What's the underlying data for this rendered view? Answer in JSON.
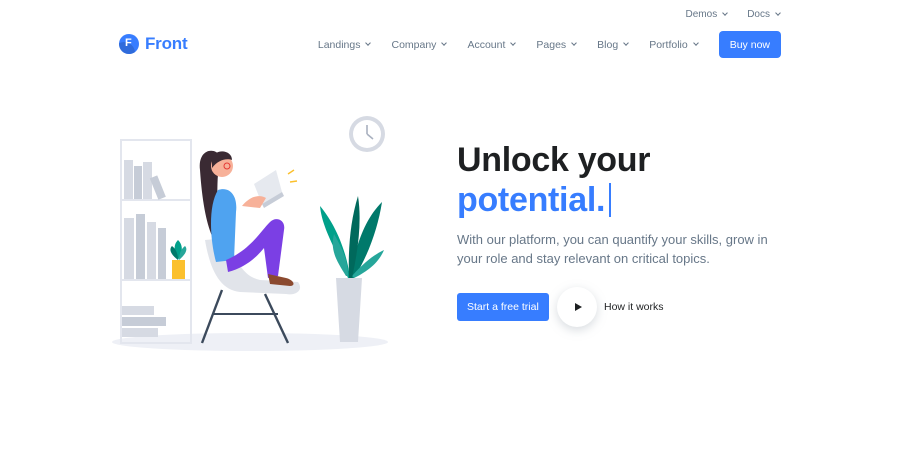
{
  "topbar": {
    "links": [
      {
        "label": "Demos"
      },
      {
        "label": "Docs"
      }
    ]
  },
  "header": {
    "logo_letter": "F",
    "logo_text": "Front",
    "nav": [
      {
        "label": "Landings"
      },
      {
        "label": "Company"
      },
      {
        "label": "Account"
      },
      {
        "label": "Pages"
      },
      {
        "label": "Blog"
      },
      {
        "label": "Portfolio"
      }
    ],
    "buy_label": "Buy now"
  },
  "hero": {
    "title_line1": "Unlock your",
    "title_line2": "potential.",
    "subtitle": "With our platform, you can quantify your skills, grow in your role and stay relevant on critical topics.",
    "cta_label": "Start a free trial",
    "how_label": "How it works"
  },
  "colors": {
    "primary": "#377dff",
    "text_dark": "#1e2022",
    "text_muted": "#677788",
    "highlight": "#fde9cf"
  },
  "icons": {
    "logo": "front-logo-icon",
    "chevron": "chevron-down-icon",
    "play": "play-icon"
  }
}
